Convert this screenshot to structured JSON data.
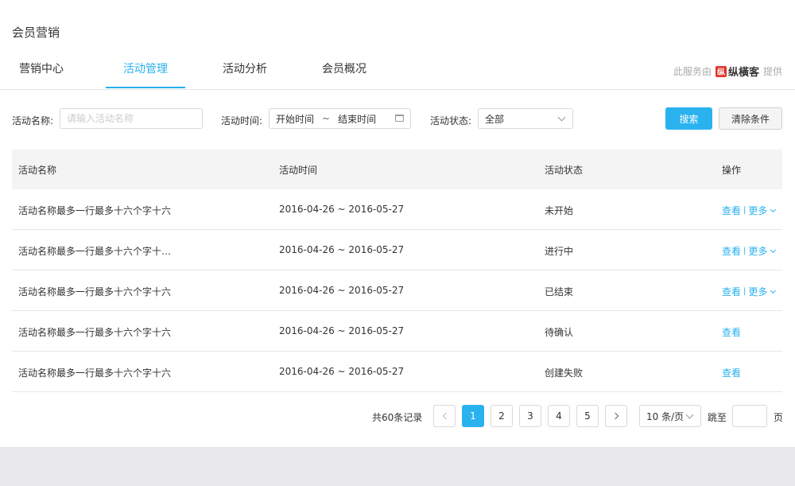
{
  "page_title": "会员营销",
  "tabs": [
    {
      "label": "营销中心",
      "active": false
    },
    {
      "label": "活动管理",
      "active": true
    },
    {
      "label": "活动分析",
      "active": false
    },
    {
      "label": "会员概况",
      "active": false
    }
  ],
  "provider": {
    "prefix": "此服务由",
    "logo_mark": "纵",
    "logo_text": "纵橫客",
    "suffix": "提供"
  },
  "filters": {
    "name_label": "活动名称:",
    "name_placeholder": "请输入活动名称",
    "time_label": "活动时间:",
    "time_start": "开始时间",
    "time_sep": "~",
    "time_end": "结束时间",
    "status_label": "活动状态:",
    "status_value": "全部",
    "search_button": "搜索",
    "clear_button": "清除条件"
  },
  "table": {
    "headers": [
      "活动名称",
      "活动时间",
      "活动状态",
      "操作"
    ],
    "rows": [
      {
        "name": "活动名称最多一行最多十六个字十六",
        "time": "2016-04-26 ~ 2016-05-27",
        "status": "未开始",
        "view": "查看",
        "sep": "|",
        "more": "更多"
      },
      {
        "name": "活动名称最多一行最多十六个字十…",
        "time": "2016-04-26 ~ 2016-05-27",
        "status": "进行中",
        "view": "查看",
        "sep": "|",
        "more": "更多"
      },
      {
        "name": "活动名称最多一行最多十六个字十六",
        "time": "2016-04-26 ~ 2016-05-27",
        "status": "已结束",
        "view": "查看",
        "sep": "|",
        "more": "更多"
      },
      {
        "name": "活动名称最多一行最多十六个字十六",
        "time": "2016-04-26 ~ 2016-05-27",
        "status": "待确认",
        "view": "查看"
      },
      {
        "name": "活动名称最多一行最多十六个字十六",
        "time": "2016-04-26 ~ 2016-05-27",
        "status": "创建失败",
        "view": "查看"
      }
    ]
  },
  "pagination": {
    "total": "共60条记录",
    "pages": [
      "1",
      "2",
      "3",
      "4",
      "5"
    ],
    "current": "1",
    "page_size": "10 条/页",
    "jump_label": "跳至",
    "jump_suffix": "页"
  },
  "colors": {
    "accent": "#2ab2ee",
    "background": "#e7e7ec"
  }
}
